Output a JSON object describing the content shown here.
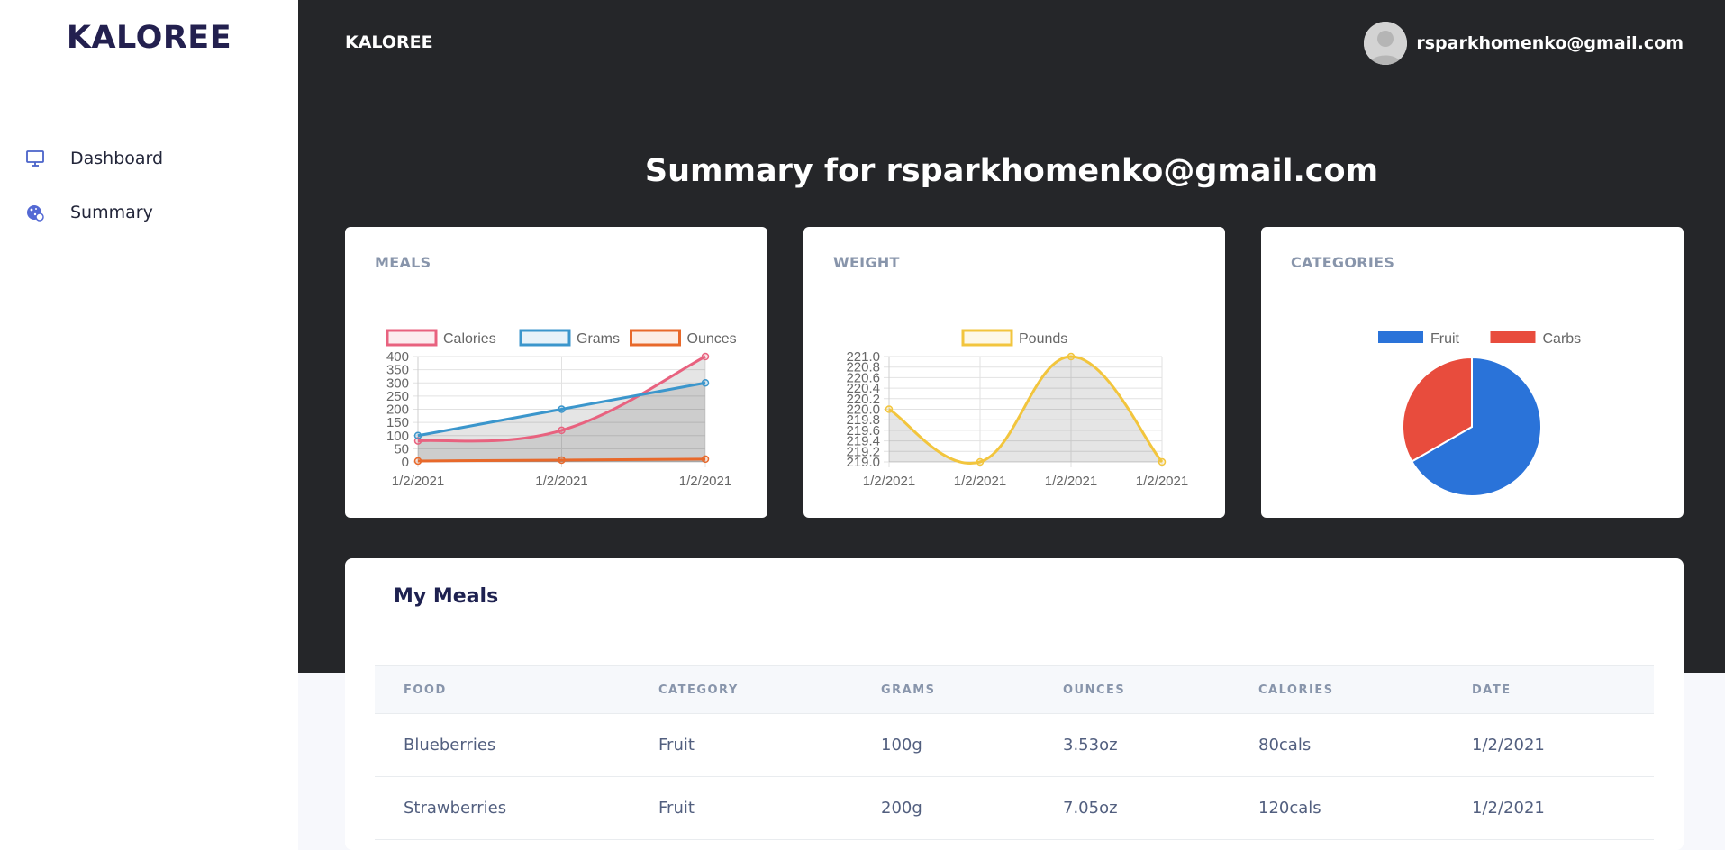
{
  "sidebar": {
    "logo": "KALOREE",
    "items": [
      {
        "label": "Dashboard",
        "icon": "monitor-icon"
      },
      {
        "label": "Summary",
        "icon": "cookie-icon"
      }
    ]
  },
  "topbar": {
    "brand": "KALOREE",
    "user_email": "rsparkhomenko@gmail.com"
  },
  "page": {
    "title": "Summary for rsparkhomenko@gmail.com"
  },
  "colors": {
    "calories": "#e8627f",
    "grams": "#3b96cc",
    "ounces": "#e8692b",
    "pounds": "#f2c53d",
    "fruit": "#2a73d9",
    "carbs": "#e84c3d",
    "dark_bg": "#252629"
  },
  "chart_data": [
    {
      "type": "line",
      "title": "MEALS",
      "x": [
        "1/2/2021",
        "1/2/2021",
        "1/2/2021"
      ],
      "series": [
        {
          "name": "Calories",
          "values": [
            80,
            120,
            400
          ]
        },
        {
          "name": "Grams",
          "values": [
            100,
            200,
            300
          ]
        },
        {
          "name": "Ounces",
          "values": [
            3.53,
            7.05,
            10.58
          ]
        }
      ],
      "yticks": [
        "400",
        "350",
        "300",
        "250",
        "200",
        "150",
        "100",
        "50",
        "0"
      ],
      "ylim": [
        0,
        400
      ],
      "legend": "top",
      "grid": true
    },
    {
      "type": "line",
      "title": "WEIGHT",
      "x": [
        "1/2/2021",
        "1/2/2021",
        "1/2/2021",
        "1/2/2021"
      ],
      "series": [
        {
          "name": "Pounds",
          "values": [
            220.0,
            219.0,
            221.0,
            219.0
          ]
        }
      ],
      "yticks": [
        "221.0",
        "220.8",
        "220.6",
        "220.4",
        "220.2",
        "220.0",
        "219.8",
        "219.6",
        "219.4",
        "219.2",
        "219.0"
      ],
      "ylim": [
        219.0,
        221.0
      ],
      "legend": "top",
      "grid": true
    },
    {
      "type": "pie",
      "title": "CATEGORIES",
      "categories": [
        "Fruit",
        "Carbs"
      ],
      "values": [
        2,
        1
      ],
      "legend": "top"
    }
  ],
  "meals": {
    "title": "My Meals",
    "columns": [
      "FOOD",
      "CATEGORY",
      "GRAMS",
      "OUNCES",
      "CALORIES",
      "DATE"
    ],
    "rows": [
      [
        "Blueberries",
        "Fruit",
        "100g",
        "3.53oz",
        "80cals",
        "1/2/2021"
      ],
      [
        "Strawberries",
        "Fruit",
        "200g",
        "7.05oz",
        "120cals",
        "1/2/2021"
      ]
    ]
  }
}
